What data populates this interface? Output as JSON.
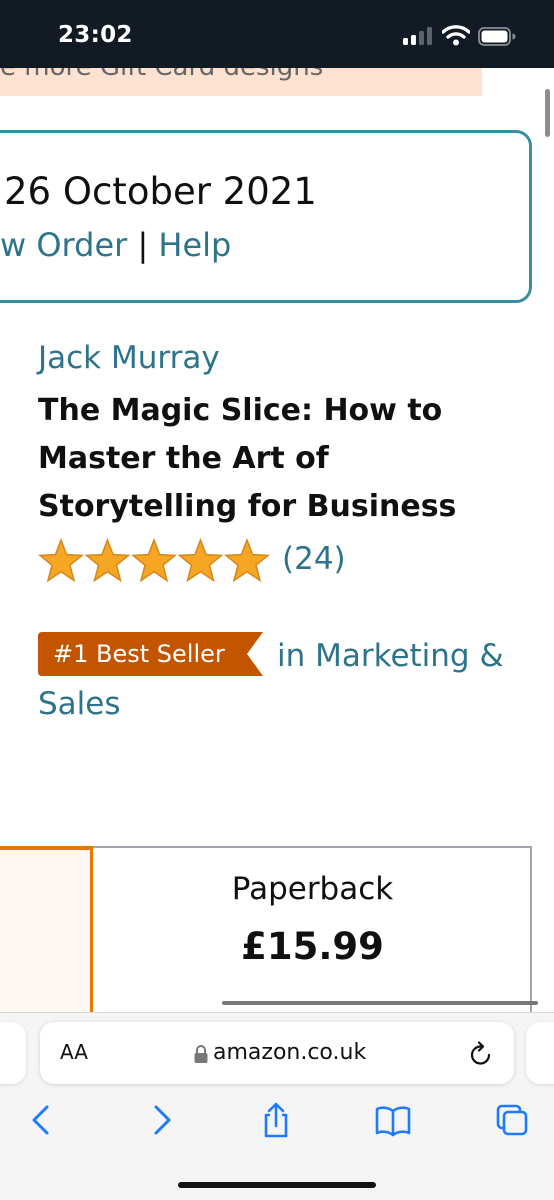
{
  "status_bar": {
    "time": "23:02",
    "icons": [
      "cellular-signal-icon",
      "wifi-icon",
      "battery-icon"
    ]
  },
  "banner": {
    "text": "e more Gift Card designs"
  },
  "delivery": {
    "date_text": "26 October 2021",
    "view_order_link": "w Order",
    "separator": "|",
    "help_link": "Help"
  },
  "product": {
    "author": "Jack Murray",
    "title": "The Magic Slice: How to Master the Art of Storytelling for Business",
    "rating_stars": 5,
    "rating_count": "(24)",
    "bestseller_badge": "#1 Best Seller",
    "bestseller_category": "in Marketing & Sales"
  },
  "formats": {
    "selected": {
      "name": "",
      "price": ""
    },
    "paperback": {
      "name": "Paperback",
      "price": "£15.99"
    }
  },
  "safari": {
    "text_size_label": "AA",
    "url": "amazon.co.uk",
    "icons": [
      "back-icon",
      "forward-icon",
      "share-icon",
      "bookmarks-icon",
      "tabs-icon",
      "reload-icon",
      "lock-icon"
    ]
  },
  "colors": {
    "link": "#2d7389",
    "box_border": "#3a8ea3",
    "star": "#f5a623",
    "badge": "#c45500",
    "selected_border": "#e77600",
    "status_bar_bg": "#121a23",
    "toolbar_icon": "#1f7aff"
  }
}
